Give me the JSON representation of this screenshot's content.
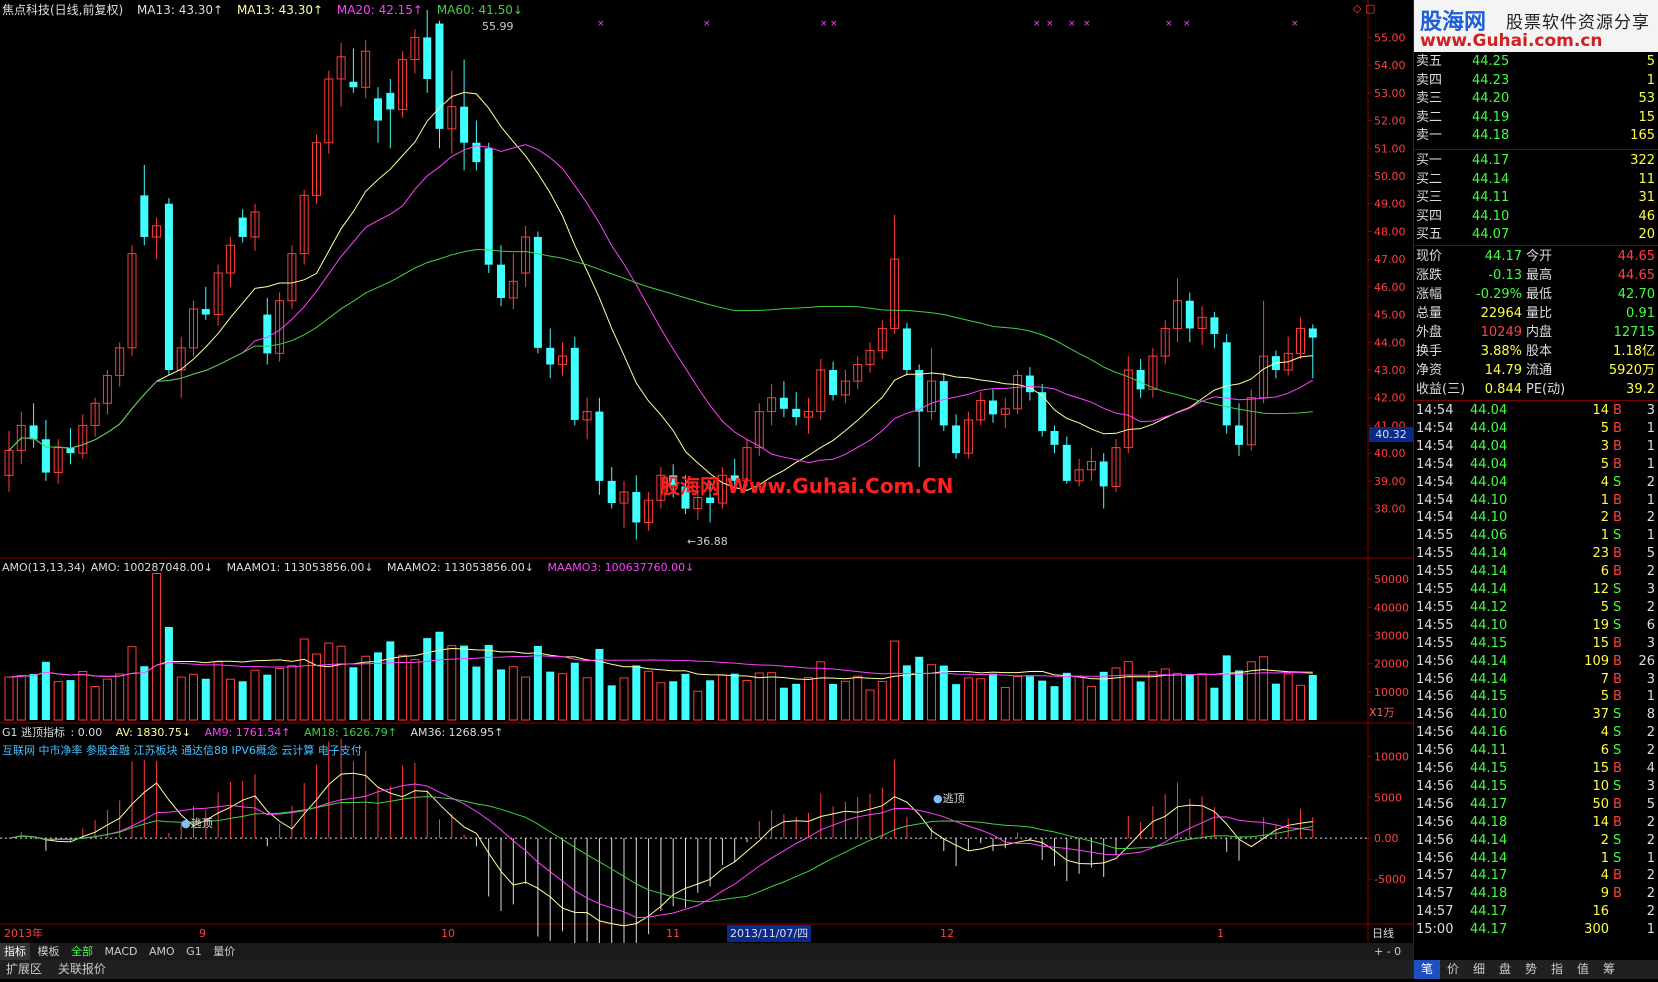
{
  "header": {
    "title": "焦点科技(日线,前复权)",
    "ma13a": "MA13: 43.30↑",
    "ma13b": "MA13: 43.30↑",
    "ma20": "MA20: 42.15↑",
    "ma60": "MA60: 41.50↓"
  },
  "colors": {
    "up": "#ff3c3c",
    "down": "#40ffff",
    "ma13": "#ffffa0",
    "ma20": "#ff40ff",
    "ma60": "#40d040",
    "bg": "#000000",
    "grid": "#8b0000"
  },
  "price_axis": [
    "55.00",
    "54.00",
    "53.00",
    "52.00",
    "51.00",
    "50.00",
    "49.00",
    "48.00",
    "47.00",
    "46.00",
    "45.00",
    "44.00",
    "43.00",
    "42.00",
    "41.00",
    "40.00",
    "39.00",
    "38.00"
  ],
  "price_high_label": "55.99",
  "price_low_label": "←36.88",
  "cursor_price": "40.32",
  "watermark": "股海网 Www.Guhai.Com.CN",
  "amo_header": {
    "name": "AMO(13,13,34)",
    "amo": "AMO: 100287048.00↓",
    "maamo1": "MAAMO1: 113053856.00↓",
    "maamo2": "MAAMO2: 113053856.00↓",
    "maamo3": "MAAMO3: 100637760.00↓"
  },
  "amo_axis": [
    "50000",
    "40000",
    "30000",
    "20000",
    "10000"
  ],
  "amo_unit": "X1万",
  "g1_header": {
    "name": "G1 逃顶指标",
    "zero": ": 0.00",
    "av": "AV: 1830.75↓",
    "am9": "AM9: 1761.54↑",
    "am18": "AM18: 1626.79↑",
    "am36": "AM36: 1268.95↑"
  },
  "g1_concepts": "互联网 中市净率 参股金融 江苏板块 通达信88 IPV6概念 云计算 电子支付",
  "g1_axis": [
    "10000",
    "5000",
    "0.00",
    "-5000"
  ],
  "g1_marks": [
    "逃顶",
    "逃顶"
  ],
  "date_axis": {
    "year": "2013年",
    "months": [
      "9",
      "10",
      "11",
      "12",
      "1"
    ],
    "cursor_date": "2013/11/07/四",
    "period": "日线"
  },
  "tabs": [
    "指标",
    "模板",
    "全部",
    "MACD",
    "AMO",
    "G1",
    "量价"
  ],
  "bottom": [
    "扩展区",
    "关联报价"
  ],
  "brand": {
    "name": "股海网",
    "tagline": "股票软件资源分享",
    "url": "www.Guhai.com.cn"
  },
  "orderbook_sell": [
    {
      "label": "卖五",
      "price": "44.25",
      "vol": "5"
    },
    {
      "label": "卖四",
      "price": "44.23",
      "vol": "1"
    },
    {
      "label": "卖三",
      "price": "44.20",
      "vol": "53"
    },
    {
      "label": "卖二",
      "price": "44.19",
      "vol": "15"
    },
    {
      "label": "卖一",
      "price": "44.18",
      "vol": "165"
    }
  ],
  "orderbook_buy": [
    {
      "label": "买一",
      "price": "44.17",
      "vol": "322"
    },
    {
      "label": "买二",
      "price": "44.14",
      "vol": "11"
    },
    {
      "label": "买三",
      "price": "44.11",
      "vol": "31"
    },
    {
      "label": "买四",
      "price": "44.10",
      "vol": "46"
    },
    {
      "label": "买五",
      "price": "44.07",
      "vol": "20"
    }
  ],
  "quote": [
    {
      "l1": "现价",
      "v1": "44.17",
      "c1": "#40ff40",
      "l2": "今开",
      "v2": "44.65",
      "c2": "#ff4040"
    },
    {
      "l1": "涨跌",
      "v1": "-0.13",
      "c1": "#40ff40",
      "l2": "最高",
      "v2": "44.65",
      "c2": "#ff4040"
    },
    {
      "l1": "涨幅",
      "v1": "-0.29%",
      "c1": "#40ff40",
      "l2": "最低",
      "v2": "42.70",
      "c2": "#40ff40"
    },
    {
      "l1": "总量",
      "v1": "22964",
      "c1": "#ffff40",
      "l2": "量比",
      "v2": "0.91",
      "c2": "#40ff40"
    },
    {
      "l1": "外盘",
      "v1": "10249",
      "c1": "#ff4040",
      "l2": "内盘",
      "v2": "12715",
      "c2": "#40ff40"
    },
    {
      "l1": "换手",
      "v1": "3.88%",
      "c1": "#ffff40",
      "l2": "股本",
      "v2": "1.18亿",
      "c2": "#ffff40"
    },
    {
      "l1": "净资",
      "v1": "14.79",
      "c1": "#ffff40",
      "l2": "流通",
      "v2": "5920万",
      "c2": "#ffff40"
    },
    {
      "l1": "收益(三)",
      "v1": "0.844",
      "c1": "#ffff40",
      "l2": "PE(动)",
      "v2": "39.2",
      "c2": "#ffff40"
    }
  ],
  "ticks": [
    {
      "t": "14:54",
      "p": "44.04",
      "v": "14",
      "d": "B",
      "n": "3"
    },
    {
      "t": "14:54",
      "p": "44.04",
      "v": "5",
      "d": "B",
      "n": "1"
    },
    {
      "t": "14:54",
      "p": "44.04",
      "v": "3",
      "d": "B",
      "n": "1"
    },
    {
      "t": "14:54",
      "p": "44.04",
      "v": "5",
      "d": "B",
      "n": "1"
    },
    {
      "t": "14:54",
      "p": "44.04",
      "v": "4",
      "d": "S",
      "n": "2"
    },
    {
      "t": "14:54",
      "p": "44.10",
      "v": "1",
      "d": "B",
      "n": "1"
    },
    {
      "t": "14:54",
      "p": "44.10",
      "v": "2",
      "d": "B",
      "n": "2"
    },
    {
      "t": "14:55",
      "p": "44.06",
      "v": "1",
      "d": "S",
      "n": "1"
    },
    {
      "t": "14:55",
      "p": "44.14",
      "v": "23",
      "d": "B",
      "n": "5"
    },
    {
      "t": "14:55",
      "p": "44.14",
      "v": "6",
      "d": "B",
      "n": "2"
    },
    {
      "t": "14:55",
      "p": "44.14",
      "v": "12",
      "d": "S",
      "n": "3"
    },
    {
      "t": "14:55",
      "p": "44.12",
      "v": "5",
      "d": "S",
      "n": "2"
    },
    {
      "t": "14:55",
      "p": "44.10",
      "v": "19",
      "d": "S",
      "n": "6"
    },
    {
      "t": "14:55",
      "p": "44.15",
      "v": "15",
      "d": "B",
      "n": "3"
    },
    {
      "t": "14:56",
      "p": "44.14",
      "v": "109",
      "d": "B",
      "n": "26"
    },
    {
      "t": "14:56",
      "p": "44.14",
      "v": "7",
      "d": "B",
      "n": "3"
    },
    {
      "t": "14:56",
      "p": "44.15",
      "v": "5",
      "d": "B",
      "n": "1"
    },
    {
      "t": "14:56",
      "p": "44.10",
      "v": "37",
      "d": "S",
      "n": "8"
    },
    {
      "t": "14:56",
      "p": "44.16",
      "v": "4",
      "d": "S",
      "n": "2"
    },
    {
      "t": "14:56",
      "p": "44.11",
      "v": "6",
      "d": "S",
      "n": "2"
    },
    {
      "t": "14:56",
      "p": "44.15",
      "v": "15",
      "d": "B",
      "n": "4"
    },
    {
      "t": "14:56",
      "p": "44.15",
      "v": "10",
      "d": "S",
      "n": "3"
    },
    {
      "t": "14:56",
      "p": "44.17",
      "v": "50",
      "d": "B",
      "n": "5"
    },
    {
      "t": "14:56",
      "p": "44.18",
      "v": "14",
      "d": "B",
      "n": "2"
    },
    {
      "t": "14:56",
      "p": "44.14",
      "v": "2",
      "d": "S",
      "n": "2"
    },
    {
      "t": "14:56",
      "p": "44.14",
      "v": "1",
      "d": "S",
      "n": "1"
    },
    {
      "t": "14:57",
      "p": "44.17",
      "v": "4",
      "d": "B",
      "n": "2"
    },
    {
      "t": "14:57",
      "p": "44.18",
      "v": "9",
      "d": "B",
      "n": "2"
    },
    {
      "t": "14:57",
      "p": "44.17",
      "v": "16",
      "d": "",
      "n": "2"
    },
    {
      "t": "15:00",
      "p": "44.17",
      "v": "300",
      "d": "",
      "n": "1"
    }
  ],
  "func_tabs": [
    "笔",
    "价",
    "细",
    "盘",
    "势",
    "指",
    "值",
    "筹"
  ],
  "chart_data": {
    "type": "candlestick",
    "series": [
      {
        "o": 39.2,
        "h": 40.8,
        "l": 38.6,
        "c": 40.1
      },
      {
        "o": 40.1,
        "h": 41.5,
        "l": 39.6,
        "c": 41.0
      },
      {
        "o": 41.0,
        "h": 41.8,
        "l": 40.2,
        "c": 40.5
      },
      {
        "o": 40.5,
        "h": 41.2,
        "l": 39.0,
        "c": 39.3
      },
      {
        "o": 39.3,
        "h": 40.5,
        "l": 38.9,
        "c": 40.2
      },
      {
        "o": 40.2,
        "h": 40.9,
        "l": 39.6,
        "c": 40.0
      },
      {
        "o": 40.0,
        "h": 41.4,
        "l": 39.8,
        "c": 41.0
      },
      {
        "o": 41.0,
        "h": 42.0,
        "l": 40.6,
        "c": 41.8
      },
      {
        "o": 41.8,
        "h": 43.0,
        "l": 41.4,
        "c": 42.8
      },
      {
        "o": 42.8,
        "h": 44.0,
        "l": 42.4,
        "c": 43.8
      },
      {
        "o": 43.8,
        "h": 47.5,
        "l": 43.5,
        "c": 47.2
      },
      {
        "o": 49.3,
        "h": 50.4,
        "l": 47.5,
        "c": 47.8
      },
      {
        "o": 47.8,
        "h": 48.5,
        "l": 47.0,
        "c": 48.2
      },
      {
        "o": 49.0,
        "h": 49.2,
        "l": 42.8,
        "c": 43.0
      },
      {
        "o": 43.0,
        "h": 44.2,
        "l": 42.0,
        "c": 43.8
      },
      {
        "o": 43.8,
        "h": 45.5,
        "l": 43.5,
        "c": 45.2
      },
      {
        "o": 45.2,
        "h": 46.0,
        "l": 44.8,
        "c": 45.0
      },
      {
        "o": 45.0,
        "h": 46.8,
        "l": 44.6,
        "c": 46.5
      },
      {
        "o": 46.5,
        "h": 47.8,
        "l": 46.0,
        "c": 47.5
      },
      {
        "o": 48.5,
        "h": 48.8,
        "l": 47.6,
        "c": 47.8
      },
      {
        "o": 47.8,
        "h": 49.0,
        "l": 47.3,
        "c": 48.7
      },
      {
        "o": 45.0,
        "h": 45.6,
        "l": 43.2,
        "c": 43.6
      },
      {
        "o": 43.6,
        "h": 45.8,
        "l": 43.3,
        "c": 45.5
      },
      {
        "o": 45.5,
        "h": 47.5,
        "l": 45.2,
        "c": 47.2
      },
      {
        "o": 47.2,
        "h": 49.5,
        "l": 46.8,
        "c": 49.3
      },
      {
        "o": 49.3,
        "h": 51.5,
        "l": 49.0,
        "c": 51.2
      },
      {
        "o": 51.2,
        "h": 53.8,
        "l": 50.8,
        "c": 53.5
      },
      {
        "o": 53.5,
        "h": 54.8,
        "l": 52.5,
        "c": 54.3
      },
      {
        "o": 53.4,
        "h": 54.6,
        "l": 53.0,
        "c": 53.2
      },
      {
        "o": 53.2,
        "h": 54.9,
        "l": 52.8,
        "c": 54.5
      },
      {
        "o": 52.8,
        "h": 53.2,
        "l": 51.2,
        "c": 52.0
      },
      {
        "o": 53.0,
        "h": 53.5,
        "l": 51.0,
        "c": 52.4
      },
      {
        "o": 52.4,
        "h": 54.5,
        "l": 52.1,
        "c": 54.2
      },
      {
        "o": 54.2,
        "h": 55.3,
        "l": 53.7,
        "c": 55.0
      },
      {
        "o": 55.0,
        "h": 55.99,
        "l": 53.0,
        "c": 53.5
      },
      {
        "o": 55.5,
        "h": 55.6,
        "l": 51.0,
        "c": 51.7
      },
      {
        "o": 51.7,
        "h": 53.8,
        "l": 50.8,
        "c": 52.5
      },
      {
        "o": 52.5,
        "h": 54.2,
        "l": 50.2,
        "c": 51.2
      },
      {
        "o": 51.2,
        "h": 52.0,
        "l": 50.2,
        "c": 50.5
      },
      {
        "o": 51.0,
        "h": 51.2,
        "l": 46.5,
        "c": 46.8
      },
      {
        "o": 46.8,
        "h": 47.5,
        "l": 45.3,
        "c": 45.6
      },
      {
        "o": 45.6,
        "h": 47.2,
        "l": 45.2,
        "c": 46.2
      },
      {
        "o": 46.5,
        "h": 48.2,
        "l": 46.0,
        "c": 47.8
      },
      {
        "o": 47.8,
        "h": 48.0,
        "l": 43.6,
        "c": 43.8
      },
      {
        "o": 43.8,
        "h": 44.5,
        "l": 42.7,
        "c": 43.2
      },
      {
        "o": 43.2,
        "h": 44.0,
        "l": 42.8,
        "c": 43.5
      },
      {
        "o": 43.8,
        "h": 44.2,
        "l": 41.0,
        "c": 41.2
      },
      {
        "o": 41.2,
        "h": 42.0,
        "l": 40.5,
        "c": 41.5
      },
      {
        "o": 41.5,
        "h": 42.0,
        "l": 38.5,
        "c": 39.0
      },
      {
        "o": 39.0,
        "h": 39.5,
        "l": 38.0,
        "c": 38.2
      },
      {
        "o": 38.2,
        "h": 39.0,
        "l": 37.3,
        "c": 38.6
      },
      {
        "o": 38.6,
        "h": 39.2,
        "l": 36.88,
        "c": 37.5
      },
      {
        "o": 37.5,
        "h": 38.6,
        "l": 37.2,
        "c": 38.3
      },
      {
        "o": 38.3,
        "h": 39.5,
        "l": 38.0,
        "c": 39.2
      },
      {
        "o": 39.2,
        "h": 39.6,
        "l": 38.4,
        "c": 38.8
      },
      {
        "o": 38.8,
        "h": 39.2,
        "l": 37.8,
        "c": 38.0
      },
      {
        "o": 38.0,
        "h": 38.6,
        "l": 37.6,
        "c": 38.4
      },
      {
        "o": 38.4,
        "h": 39.0,
        "l": 37.5,
        "c": 38.2
      },
      {
        "o": 38.2,
        "h": 39.5,
        "l": 38.0,
        "c": 39.2
      },
      {
        "o": 39.2,
        "h": 39.8,
        "l": 38.6,
        "c": 39.0
      },
      {
        "o": 39.0,
        "h": 40.5,
        "l": 38.8,
        "c": 40.2
      },
      {
        "o": 40.2,
        "h": 41.8,
        "l": 39.9,
        "c": 41.5
      },
      {
        "o": 41.5,
        "h": 42.5,
        "l": 41.0,
        "c": 42.0
      },
      {
        "o": 42.0,
        "h": 42.6,
        "l": 41.3,
        "c": 41.6
      },
      {
        "o": 41.6,
        "h": 42.2,
        "l": 41.0,
        "c": 41.3
      },
      {
        "o": 41.3,
        "h": 42.0,
        "l": 40.7,
        "c": 41.5
      },
      {
        "o": 41.5,
        "h": 43.4,
        "l": 41.2,
        "c": 43.0
      },
      {
        "o": 43.0,
        "h": 43.3,
        "l": 41.9,
        "c": 42.1
      },
      {
        "o": 42.1,
        "h": 43.0,
        "l": 41.8,
        "c": 42.6
      },
      {
        "o": 42.6,
        "h": 43.5,
        "l": 42.3,
        "c": 43.2
      },
      {
        "o": 43.2,
        "h": 44.0,
        "l": 42.9,
        "c": 43.7
      },
      {
        "o": 43.7,
        "h": 44.8,
        "l": 43.4,
        "c": 44.5
      },
      {
        "o": 44.5,
        "h": 48.6,
        "l": 44.3,
        "c": 47.0
      },
      {
        "o": 44.5,
        "h": 44.7,
        "l": 42.8,
        "c": 43.0
      },
      {
        "o": 43.0,
        "h": 43.2,
        "l": 39.5,
        "c": 41.5
      },
      {
        "o": 41.5,
        "h": 43.8,
        "l": 41.2,
        "c": 42.6
      },
      {
        "o": 42.6,
        "h": 42.9,
        "l": 40.8,
        "c": 41.0
      },
      {
        "o": 41.0,
        "h": 41.4,
        "l": 39.8,
        "c": 40.0
      },
      {
        "o": 40.0,
        "h": 41.5,
        "l": 39.8,
        "c": 41.2
      },
      {
        "o": 41.2,
        "h": 42.2,
        "l": 41.0,
        "c": 41.9
      },
      {
        "o": 41.9,
        "h": 42.3,
        "l": 41.1,
        "c": 41.4
      },
      {
        "o": 41.4,
        "h": 42.0,
        "l": 40.9,
        "c": 41.6
      },
      {
        "o": 41.6,
        "h": 43.0,
        "l": 41.4,
        "c": 42.8
      },
      {
        "o": 42.8,
        "h": 43.1,
        "l": 41.9,
        "c": 42.2
      },
      {
        "o": 42.2,
        "h": 42.5,
        "l": 40.6,
        "c": 40.8
      },
      {
        "o": 40.8,
        "h": 41.0,
        "l": 40.0,
        "c": 40.3
      },
      {
        "o": 40.3,
        "h": 40.6,
        "l": 38.9,
        "c": 39.0
      },
      {
        "o": 39.0,
        "h": 39.8,
        "l": 38.8,
        "c": 39.4
      },
      {
        "o": 39.4,
        "h": 40.2,
        "l": 39.0,
        "c": 39.7
      },
      {
        "o": 39.7,
        "h": 40.0,
        "l": 38.0,
        "c": 38.8
      },
      {
        "o": 38.8,
        "h": 40.5,
        "l": 38.6,
        "c": 40.2
      },
      {
        "o": 40.2,
        "h": 43.5,
        "l": 40.0,
        "c": 43.0
      },
      {
        "o": 43.0,
        "h": 43.4,
        "l": 42.0,
        "c": 42.3
      },
      {
        "o": 42.3,
        "h": 43.8,
        "l": 42.0,
        "c": 43.5
      },
      {
        "o": 43.5,
        "h": 44.8,
        "l": 43.2,
        "c": 44.5
      },
      {
        "o": 44.5,
        "h": 46.3,
        "l": 44.0,
        "c": 45.5
      },
      {
        "o": 45.5,
        "h": 45.8,
        "l": 44.0,
        "c": 44.5
      },
      {
        "o": 44.5,
        "h": 45.3,
        "l": 43.9,
        "c": 44.9
      },
      {
        "o": 44.9,
        "h": 45.1,
        "l": 43.8,
        "c": 44.3
      },
      {
        "o": 44.0,
        "h": 44.3,
        "l": 40.7,
        "c": 41.0
      },
      {
        "o": 41.0,
        "h": 41.8,
        "l": 39.9,
        "c": 40.3
      },
      {
        "o": 40.3,
        "h": 42.3,
        "l": 40.1,
        "c": 42.0
      },
      {
        "o": 42.0,
        "h": 45.5,
        "l": 41.8,
        "c": 43.5
      },
      {
        "o": 43.5,
        "h": 43.7,
        "l": 42.7,
        "c": 43.0
      },
      {
        "o": 43.0,
        "h": 44.2,
        "l": 42.8,
        "c": 43.6
      },
      {
        "o": 43.6,
        "h": 44.9,
        "l": 43.4,
        "c": 44.5
      },
      {
        "o": 44.5,
        "h": 44.65,
        "l": 42.7,
        "c": 44.17
      }
    ]
  }
}
